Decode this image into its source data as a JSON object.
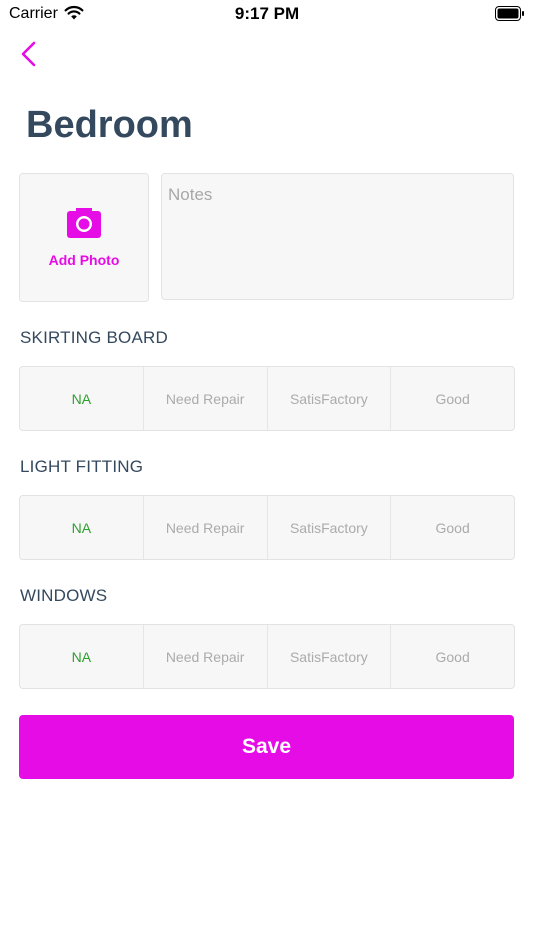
{
  "status_bar": {
    "carrier": "Carrier",
    "time": "9:17 PM"
  },
  "header": {
    "title": "Bedroom"
  },
  "photo": {
    "label": "Add Photo"
  },
  "notes": {
    "placeholder": "Notes",
    "value": ""
  },
  "sections": [
    {
      "title": "SKIRTING BOARD",
      "options": [
        "NA",
        "Need Repair",
        "SatisFactory",
        "Good"
      ],
      "selected": "NA"
    },
    {
      "title": "LIGHT FITTING",
      "options": [
        "NA",
        "Need Repair",
        "SatisFactory",
        "Good"
      ],
      "selected": "NA"
    },
    {
      "title": "WINDOWS",
      "options": [
        "NA",
        "Need Repair",
        "SatisFactory",
        "Good"
      ],
      "selected": "NA"
    }
  ],
  "save": {
    "label": "Save"
  },
  "colors": {
    "accent": "#e60ce6",
    "selected": "#2f9e2f",
    "text": "#34495e",
    "muted": "#ababab"
  },
  "icons": {
    "back": "chevron-left-icon",
    "camera": "camera-icon",
    "wifi": "wifi-icon",
    "battery": "battery-icon"
  }
}
